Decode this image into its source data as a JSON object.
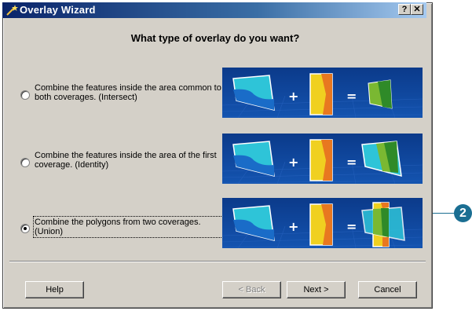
{
  "window": {
    "title": "Overlay Wizard",
    "help_btn": "?",
    "close_btn": "✕"
  },
  "heading": "What type of overlay do you want?",
  "options": [
    {
      "label": "Combine the features inside the area common to both coverages. (Intersect)",
      "selected": false
    },
    {
      "label": "Combine the features inside the area of the first coverage. (Identity)",
      "selected": false
    },
    {
      "label": "Combine the polygons from two coverages. (Union)",
      "selected": true
    }
  ],
  "panel_symbols": {
    "plus": "+",
    "equals": "="
  },
  "buttons": {
    "help": "Help",
    "back": "< Back",
    "next": "Next >",
    "cancel": "Cancel"
  },
  "callout": "2",
  "colors": {
    "title_bar": "#0a246a",
    "panel_bg": "#0c3d8c",
    "callout": "#1a6e92"
  }
}
